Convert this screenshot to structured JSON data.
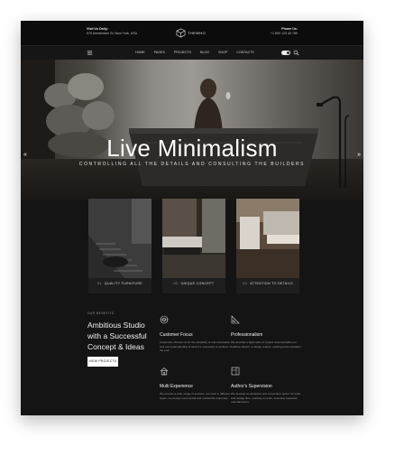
{
  "topbar": {
    "left_title": "Visit Us Daily:",
    "left_text": "570 Amsterdam St, New York, USA",
    "right_title": "Phone Us:",
    "right_text": "+1 800 123 45 789"
  },
  "logo": {
    "text": "THEWHO",
    "icon": "cube-logo-icon"
  },
  "nav": {
    "menu_icon": "hamburger-menu-icon",
    "items": [
      "HOME",
      "PAGES",
      "PROJECTS",
      "BLOG",
      "SHOP",
      "CONTACTS"
    ],
    "search_icon": "search-icon"
  },
  "hero": {
    "title": "Live Minimalism",
    "subtitle": "CONTROLLING ALL THE DETAILS AND CONSULTING THE BUILDERS",
    "prev_arrow": "«",
    "next_arrow": "»"
  },
  "cards": [
    {
      "num": "01.",
      "label": "QUALITY FURNITURE"
    },
    {
      "num": "02.",
      "label": "UNIQUE CONCEPT"
    },
    {
      "num": "03.",
      "label": "ATTENTION TO DETAILS"
    }
  ],
  "studio": {
    "eyebrow": "OUR BENEFITS",
    "title_lines": [
      "Ambitious Studio",
      "with a Successful",
      "Concept & Ideas"
    ],
    "button": "VIEW PROJECTS"
  },
  "features": [
    {
      "icon": "target-icon",
      "title": "Customer Focus",
      "text": "Customers choose us for the simplicity of communication and our understanding of what it's necessary to achieve in the end."
    },
    {
      "icon": "triangle-ruler-icon",
      "title": "Professionalism",
      "text": "We develop a high value of project documentation on realtime sketch, a design project, existing documentation."
    },
    {
      "icon": "house-icon",
      "title": "Multi Experience",
      "text": "We provide a wide range of services, we work in different styles, we design commercial and residential properties."
    },
    {
      "icon": "blueprint-icon",
      "title": "Author's Supervision",
      "text": "We develop an attractive and convenient option for work and design time, working on units, selecting materials, manufacturers."
    }
  ],
  "colors": {
    "background": "#141414",
    "topbar": "#0c0c0c",
    "accent": "#ffffff"
  }
}
